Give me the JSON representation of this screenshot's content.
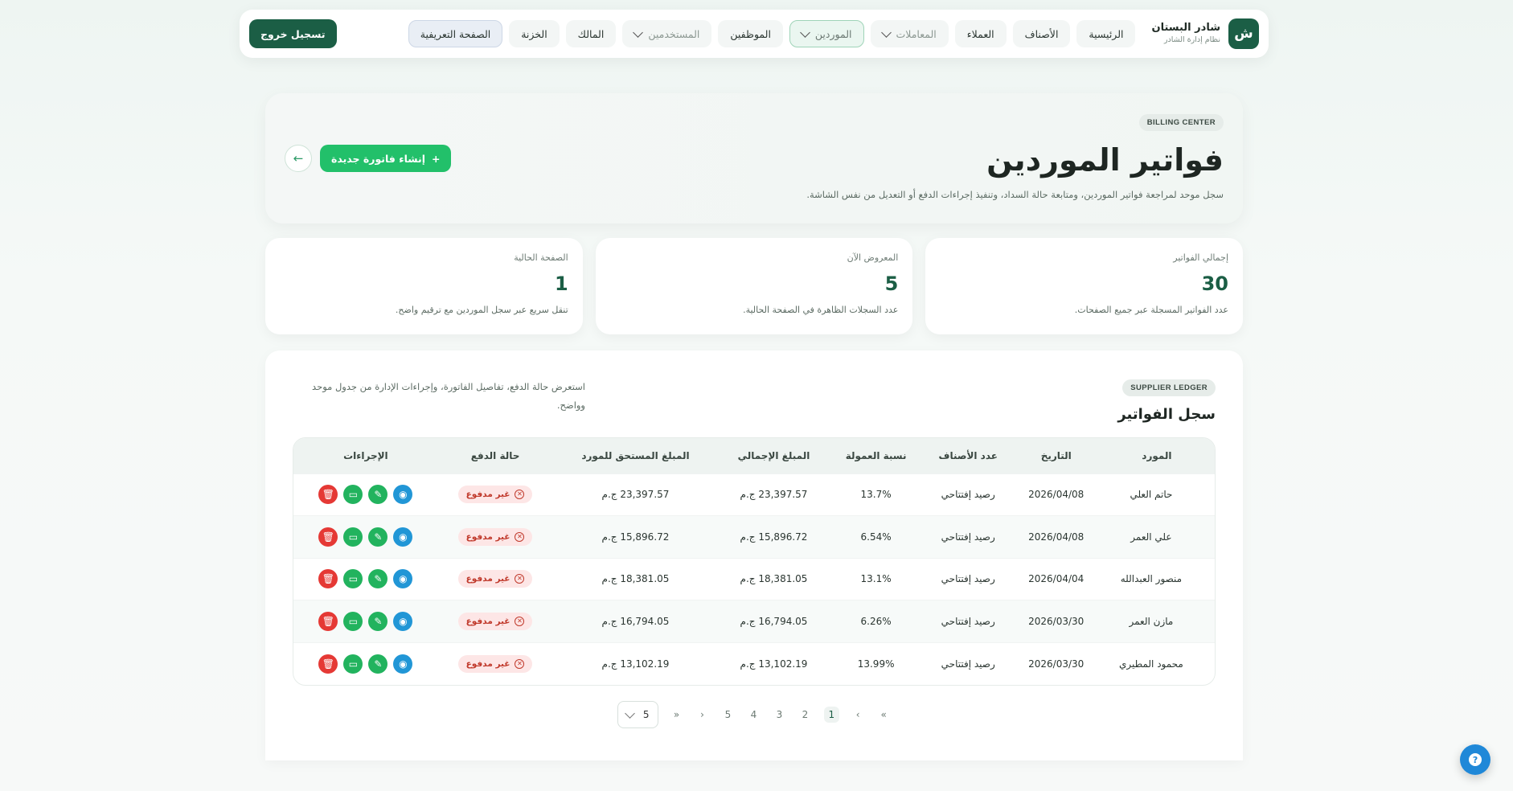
{
  "nav": {
    "brand_logo": "ش",
    "brand_name": "شادر البستان",
    "brand_sub": "نظام إدارة الشادر",
    "items": [
      {
        "label": "الرئيسية"
      },
      {
        "label": "الأصناف"
      },
      {
        "label": "العملاء"
      },
      {
        "label": "المعاملات"
      },
      {
        "label": "الموردين"
      },
      {
        "label": "الموظفين"
      },
      {
        "label": "المستخدمين"
      },
      {
        "label": "المالك"
      },
      {
        "label": "الخزنة"
      },
      {
        "label": "الصفحة التعريفية"
      }
    ],
    "logout_label": "تسجيل خروج"
  },
  "hero": {
    "pill": "BILLING CENTER",
    "title": "فواتير الموردين",
    "description": "سجل موحد لمراجعة فواتير الموردين، ومتابعة حالة السداد، وتنفيذ إجراءات الدفع أو التعديل من نفس الشاشة.",
    "create_label": "إنشاء فاتورة جديدة",
    "create_icon": "plus-icon",
    "back_icon": "arrow-left-icon"
  },
  "stats": [
    {
      "label": "إجمالي الفواتير",
      "value": "30",
      "desc": "عدد الفواتير المسجلة عبر جميع الصفحات."
    },
    {
      "label": "المعروض الآن",
      "value": "5",
      "desc": "عدد السجلات الظاهرة في الصفحة الحالية."
    },
    {
      "label": "الصفحة الحالية",
      "value": "1",
      "desc": "تنقل سريع عبر سجل الموردين مع ترقيم واضح."
    }
  ],
  "ledger": {
    "pill": "SUPPLIER LEDGER",
    "title": "سجل الفواتير",
    "description": "استعرض حالة الدفع، تفاصيل الفاتورة، وإجراءات الإدارة من جدول موحد وواضح."
  },
  "table": {
    "headers": [
      "المورد",
      "التاريخ",
      "عدد الأصناف",
      "نسبة العمولة",
      "المبلغ الإجمالي",
      "المبلغ المستحق للمورد",
      "حالة الدفع",
      "الإجراءات"
    ],
    "rows": [
      {
        "supplier": "حاتم العلي",
        "date": "2026/04/08",
        "items": "رصيد إفتتاحي",
        "commission": "13.7%",
        "total": "23,397.57 ج.م",
        "due": "23,397.57 ج.م",
        "status": "غير مدفوع"
      },
      {
        "supplier": "علي العمر",
        "date": "2026/04/08",
        "items": "رصيد إفتتاحي",
        "commission": "6.54%",
        "total": "15,896.72 ج.م",
        "due": "15,896.72 ج.م",
        "status": "غير مدفوع"
      },
      {
        "supplier": "منصور العبدالله",
        "date": "2026/04/04",
        "items": "رصيد إفتتاحي",
        "commission": "13.1%",
        "total": "18,381.05 ج.م",
        "due": "18,381.05 ج.م",
        "status": "غير مدفوع"
      },
      {
        "supplier": "مازن العمر",
        "date": "2026/03/30",
        "items": "رصيد إفتتاحي",
        "commission": "6.26%",
        "total": "16,794.05 ج.م",
        "due": "16,794.05 ج.م",
        "status": "غير مدفوع"
      },
      {
        "supplier": "محمود المطيري",
        "date": "2026/03/30",
        "items": "رصيد إفتتاحي",
        "commission": "13.99%",
        "total": "13,102.19 ج.م",
        "due": "13,102.19 ج.م",
        "status": "غير مدفوع"
      }
    ],
    "action_icons": [
      "eye-icon",
      "pencil-icon",
      "money-icon",
      "trash-icon"
    ]
  },
  "pagination": {
    "first": "«",
    "prev": "‹",
    "pages": [
      "1",
      "2",
      "3",
      "4",
      "5"
    ],
    "next": "›",
    "last": "»",
    "current": "1",
    "per_page": "5"
  },
  "help": {
    "label": "?"
  },
  "colors": {
    "brand": "#1b5e45",
    "accent": "#22c06a",
    "danger": "#e53935",
    "info": "#2196d6"
  }
}
